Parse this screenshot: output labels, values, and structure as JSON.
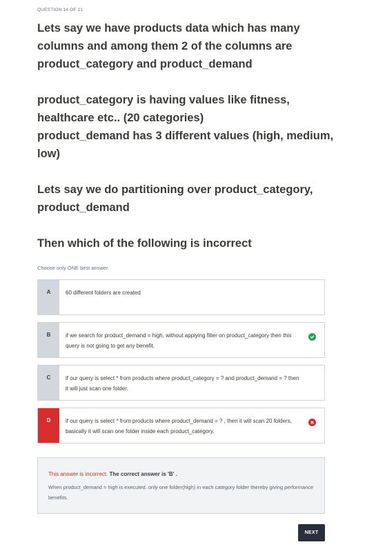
{
  "header": {
    "question_counter": "QUESTION 14 OF 21"
  },
  "question": {
    "paragraphs": [
      "Lets say we have products data which has many columns and among them 2 of the columns are product_category and product_demand",
      "product_category is having values like fitness, healthcare etc.. (20 categories)\nproduct_demand has 3 different values (high, medium, low)",
      "Lets say we do partitioning over product_category, product_demand",
      "Then which of the following is incorrect"
    ]
  },
  "instruction": "Choose only ONE best answer.",
  "answers": [
    {
      "letter": "A",
      "text": "60 different folders are created",
      "status": "none"
    },
    {
      "letter": "B",
      "text": "if we search for product_demand = high, without applying filter on product_category then this query is not going to get any benefit.",
      "status": "correct"
    },
    {
      "letter": "C",
      "text": "if our query is select * from products where product_category = ? and product_demand = ? then it will just scan one folder.",
      "status": "none"
    },
    {
      "letter": "D",
      "text": "if our query is select * from products where product_demand = ? , then it will scan 20 folders, basically it will scan one folder inside each product_category.",
      "status": "selected-incorrect"
    }
  ],
  "icons": {
    "correct": "check-circle-icon",
    "incorrect": "x-circle-icon"
  },
  "colors": {
    "incorrect": "#d92d2d",
    "correct": "#2e9e55",
    "button": "#29303b"
  },
  "feedback": {
    "incorrect_label": "This answer is incorrect.",
    "correct_answer_text": "The correct answer is 'B' .",
    "explanation": "When product_demand = high is executed. only one folder(high) in each category folder thereby giving performance benefits."
  },
  "buttons": {
    "next_label": "NEXT"
  }
}
